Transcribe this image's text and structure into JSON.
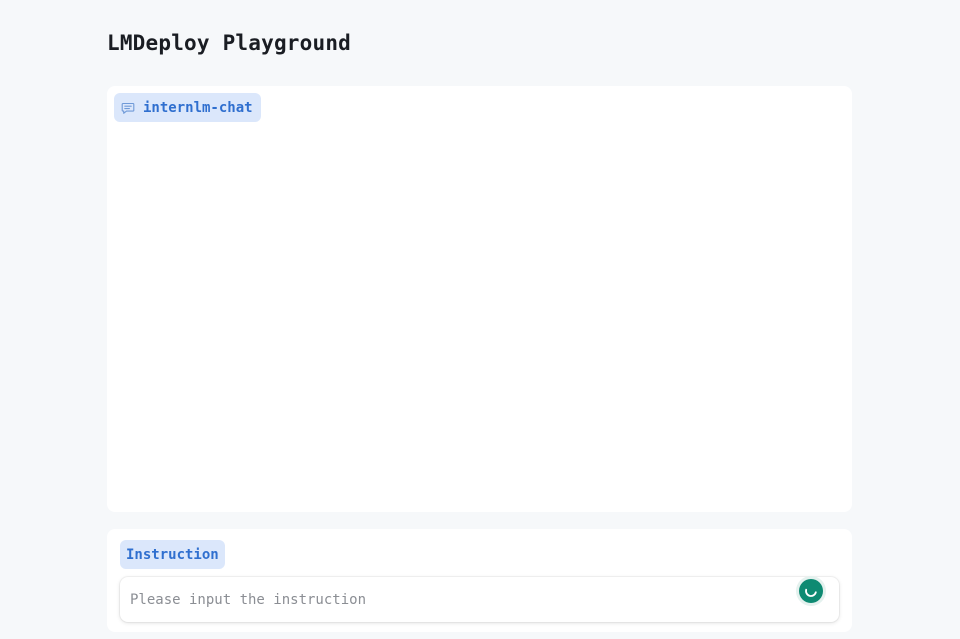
{
  "app": {
    "title": "LMDeploy Playground"
  },
  "chatbot": {
    "label": "internlm-chat",
    "icon": "chat-bubble-icon"
  },
  "instruction": {
    "label": "Instruction",
    "placeholder": "Please input the instruction",
    "value": ""
  },
  "status": {
    "icon": "loading-spinner-icon"
  },
  "colors": {
    "background": "#f6f8fa",
    "panel": "#ffffff",
    "label_bg": "#dbe7fb",
    "label_text": "#2f6fcf",
    "spinner": "#0e8a72"
  }
}
